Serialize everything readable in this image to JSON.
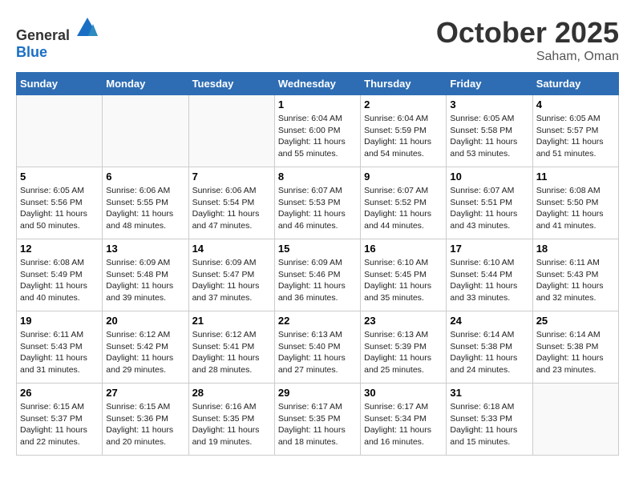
{
  "header": {
    "logo_general": "General",
    "logo_blue": "Blue",
    "month": "October 2025",
    "location": "Saham, Oman"
  },
  "weekdays": [
    "Sunday",
    "Monday",
    "Tuesday",
    "Wednesday",
    "Thursday",
    "Friday",
    "Saturday"
  ],
  "weeks": [
    [
      {
        "day": "",
        "sunrise": "",
        "sunset": "",
        "daylight": ""
      },
      {
        "day": "",
        "sunrise": "",
        "sunset": "",
        "daylight": ""
      },
      {
        "day": "",
        "sunrise": "",
        "sunset": "",
        "daylight": ""
      },
      {
        "day": "1",
        "sunrise": "Sunrise: 6:04 AM",
        "sunset": "Sunset: 6:00 PM",
        "daylight": "Daylight: 11 hours and 55 minutes."
      },
      {
        "day": "2",
        "sunrise": "Sunrise: 6:04 AM",
        "sunset": "Sunset: 5:59 PM",
        "daylight": "Daylight: 11 hours and 54 minutes."
      },
      {
        "day": "3",
        "sunrise": "Sunrise: 6:05 AM",
        "sunset": "Sunset: 5:58 PM",
        "daylight": "Daylight: 11 hours and 53 minutes."
      },
      {
        "day": "4",
        "sunrise": "Sunrise: 6:05 AM",
        "sunset": "Sunset: 5:57 PM",
        "daylight": "Daylight: 11 hours and 51 minutes."
      }
    ],
    [
      {
        "day": "5",
        "sunrise": "Sunrise: 6:05 AM",
        "sunset": "Sunset: 5:56 PM",
        "daylight": "Daylight: 11 hours and 50 minutes."
      },
      {
        "day": "6",
        "sunrise": "Sunrise: 6:06 AM",
        "sunset": "Sunset: 5:55 PM",
        "daylight": "Daylight: 11 hours and 48 minutes."
      },
      {
        "day": "7",
        "sunrise": "Sunrise: 6:06 AM",
        "sunset": "Sunset: 5:54 PM",
        "daylight": "Daylight: 11 hours and 47 minutes."
      },
      {
        "day": "8",
        "sunrise": "Sunrise: 6:07 AM",
        "sunset": "Sunset: 5:53 PM",
        "daylight": "Daylight: 11 hours and 46 minutes."
      },
      {
        "day": "9",
        "sunrise": "Sunrise: 6:07 AM",
        "sunset": "Sunset: 5:52 PM",
        "daylight": "Daylight: 11 hours and 44 minutes."
      },
      {
        "day": "10",
        "sunrise": "Sunrise: 6:07 AM",
        "sunset": "Sunset: 5:51 PM",
        "daylight": "Daylight: 11 hours and 43 minutes."
      },
      {
        "day": "11",
        "sunrise": "Sunrise: 6:08 AM",
        "sunset": "Sunset: 5:50 PM",
        "daylight": "Daylight: 11 hours and 41 minutes."
      }
    ],
    [
      {
        "day": "12",
        "sunrise": "Sunrise: 6:08 AM",
        "sunset": "Sunset: 5:49 PM",
        "daylight": "Daylight: 11 hours and 40 minutes."
      },
      {
        "day": "13",
        "sunrise": "Sunrise: 6:09 AM",
        "sunset": "Sunset: 5:48 PM",
        "daylight": "Daylight: 11 hours and 39 minutes."
      },
      {
        "day": "14",
        "sunrise": "Sunrise: 6:09 AM",
        "sunset": "Sunset: 5:47 PM",
        "daylight": "Daylight: 11 hours and 37 minutes."
      },
      {
        "day": "15",
        "sunrise": "Sunrise: 6:09 AM",
        "sunset": "Sunset: 5:46 PM",
        "daylight": "Daylight: 11 hours and 36 minutes."
      },
      {
        "day": "16",
        "sunrise": "Sunrise: 6:10 AM",
        "sunset": "Sunset: 5:45 PM",
        "daylight": "Daylight: 11 hours and 35 minutes."
      },
      {
        "day": "17",
        "sunrise": "Sunrise: 6:10 AM",
        "sunset": "Sunset: 5:44 PM",
        "daylight": "Daylight: 11 hours and 33 minutes."
      },
      {
        "day": "18",
        "sunrise": "Sunrise: 6:11 AM",
        "sunset": "Sunset: 5:43 PM",
        "daylight": "Daylight: 11 hours and 32 minutes."
      }
    ],
    [
      {
        "day": "19",
        "sunrise": "Sunrise: 6:11 AM",
        "sunset": "Sunset: 5:43 PM",
        "daylight": "Daylight: 11 hours and 31 minutes."
      },
      {
        "day": "20",
        "sunrise": "Sunrise: 6:12 AM",
        "sunset": "Sunset: 5:42 PM",
        "daylight": "Daylight: 11 hours and 29 minutes."
      },
      {
        "day": "21",
        "sunrise": "Sunrise: 6:12 AM",
        "sunset": "Sunset: 5:41 PM",
        "daylight": "Daylight: 11 hours and 28 minutes."
      },
      {
        "day": "22",
        "sunrise": "Sunrise: 6:13 AM",
        "sunset": "Sunset: 5:40 PM",
        "daylight": "Daylight: 11 hours and 27 minutes."
      },
      {
        "day": "23",
        "sunrise": "Sunrise: 6:13 AM",
        "sunset": "Sunset: 5:39 PM",
        "daylight": "Daylight: 11 hours and 25 minutes."
      },
      {
        "day": "24",
        "sunrise": "Sunrise: 6:14 AM",
        "sunset": "Sunset: 5:38 PM",
        "daylight": "Daylight: 11 hours and 24 minutes."
      },
      {
        "day": "25",
        "sunrise": "Sunrise: 6:14 AM",
        "sunset": "Sunset: 5:38 PM",
        "daylight": "Daylight: 11 hours and 23 minutes."
      }
    ],
    [
      {
        "day": "26",
        "sunrise": "Sunrise: 6:15 AM",
        "sunset": "Sunset: 5:37 PM",
        "daylight": "Daylight: 11 hours and 22 minutes."
      },
      {
        "day": "27",
        "sunrise": "Sunrise: 6:15 AM",
        "sunset": "Sunset: 5:36 PM",
        "daylight": "Daylight: 11 hours and 20 minutes."
      },
      {
        "day": "28",
        "sunrise": "Sunrise: 6:16 AM",
        "sunset": "Sunset: 5:35 PM",
        "daylight": "Daylight: 11 hours and 19 minutes."
      },
      {
        "day": "29",
        "sunrise": "Sunrise: 6:17 AM",
        "sunset": "Sunset: 5:35 PM",
        "daylight": "Daylight: 11 hours and 18 minutes."
      },
      {
        "day": "30",
        "sunrise": "Sunrise: 6:17 AM",
        "sunset": "Sunset: 5:34 PM",
        "daylight": "Daylight: 11 hours and 16 minutes."
      },
      {
        "day": "31",
        "sunrise": "Sunrise: 6:18 AM",
        "sunset": "Sunset: 5:33 PM",
        "daylight": "Daylight: 11 hours and 15 minutes."
      },
      {
        "day": "",
        "sunrise": "",
        "sunset": "",
        "daylight": ""
      }
    ]
  ]
}
